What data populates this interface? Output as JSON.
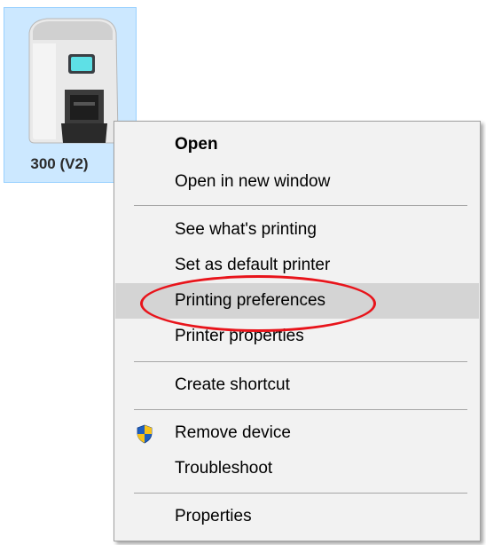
{
  "printer": {
    "label": "300 (V2)",
    "icon": "card-printer-icon",
    "selected": true
  },
  "context_menu": {
    "items": [
      {
        "label": "Open",
        "bold": true
      },
      {
        "label": "Open in new window"
      },
      {
        "label": "See what's printing"
      },
      {
        "label": "Set as default printer"
      },
      {
        "label": "Printing preferences",
        "highlighted": true
      },
      {
        "label": "Printer properties"
      },
      {
        "label": "Create shortcut"
      },
      {
        "label": "Remove device",
        "icon": "uac-shield-icon"
      },
      {
        "label": "Troubleshoot"
      },
      {
        "label": "Properties"
      }
    ]
  },
  "colors": {
    "selection_fill": "#cce8ff",
    "selection_border": "#99d1ff",
    "menu_background": "#f2f2f2",
    "menu_highlight": "#d4d4d4",
    "annotation": "#e8141b"
  }
}
